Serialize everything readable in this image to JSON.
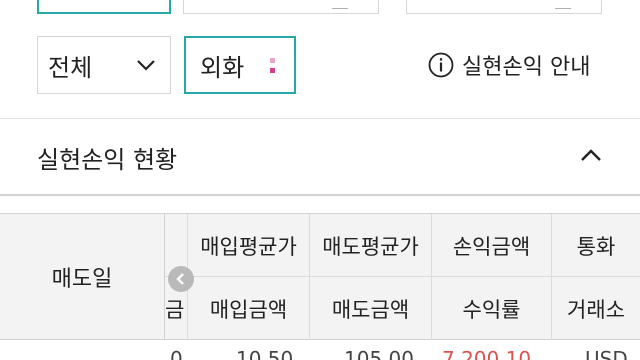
{
  "filters": {
    "period_select": {
      "value": "전체"
    },
    "currency_select": {
      "value": "외화"
    },
    "info_link": {
      "label": "실현손익 안내"
    }
  },
  "section": {
    "title": "실현손익 현황"
  },
  "table": {
    "fixed_header": "매도일",
    "header_row1": [
      "",
      "매입평균가",
      "매도평균가",
      "손익금액",
      "통화"
    ],
    "header_row2": [
      "금",
      "매입금액",
      "매도금액",
      "수익률",
      "거래소"
    ],
    "first_row_partial": [
      "0",
      "10.50",
      "105.00",
      "7,200.10",
      "USD"
    ]
  },
  "colors": {
    "accent": "#27a8a8",
    "dots": [
      "#e5a7c9",
      "#d23f8a"
    ],
    "profit": "#d9534f",
    "header_bg": "#f3f3f3"
  }
}
